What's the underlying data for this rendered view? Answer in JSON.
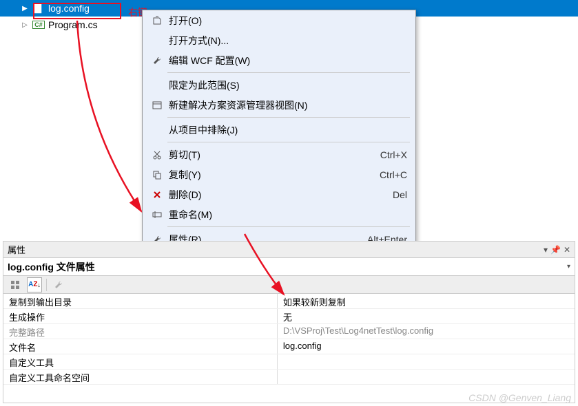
{
  "tree": {
    "items": [
      {
        "label": "log.config",
        "selected": true
      },
      {
        "label": "Program.cs",
        "selected": false
      }
    ]
  },
  "annotations": {
    "right_click_label": "右键"
  },
  "contextMenu": {
    "items": [
      {
        "label": "打开(O)",
        "icon": "open",
        "shortcut": ""
      },
      {
        "label": "打开方式(N)...",
        "icon": "",
        "shortcut": ""
      },
      {
        "label": "编辑 WCF 配置(W)",
        "icon": "wrench",
        "shortcut": ""
      },
      {
        "label": "限定为此范围(S)",
        "icon": "",
        "shortcut": ""
      },
      {
        "label": "新建解决方案资源管理器视图(N)",
        "icon": "window",
        "shortcut": ""
      },
      {
        "label": "从项目中排除(J)",
        "icon": "",
        "shortcut": ""
      },
      {
        "label": "剪切(T)",
        "icon": "cut",
        "shortcut": "Ctrl+X"
      },
      {
        "label": "复制(Y)",
        "icon": "copy",
        "shortcut": "Ctrl+C"
      },
      {
        "label": "删除(D)",
        "icon": "delete",
        "shortcut": "Del"
      },
      {
        "label": "重命名(M)",
        "icon": "rename",
        "shortcut": ""
      },
      {
        "label": "属性(R)",
        "icon": "wrench",
        "shortcut": "Alt+Enter"
      }
    ]
  },
  "properties": {
    "panelTitle": "属性",
    "fileLabel": "log.config 文件属性",
    "rows": [
      {
        "name": "复制到输出目录",
        "value": "如果较新则复制",
        "readonly": false,
        "highlighted": true
      },
      {
        "name": "生成操作",
        "value": "无",
        "readonly": false
      },
      {
        "name": "完整路径",
        "value": "D:\\VSProj\\Test\\Log4netTest\\log.config",
        "readonly": true
      },
      {
        "name": "文件名",
        "value": "log.config",
        "readonly": false
      },
      {
        "name": "自定义工具",
        "value": "",
        "readonly": false
      },
      {
        "name": "自定义工具命名空间",
        "value": "",
        "readonly": false
      }
    ]
  },
  "watermark": "CSDN @Genven_Liang"
}
